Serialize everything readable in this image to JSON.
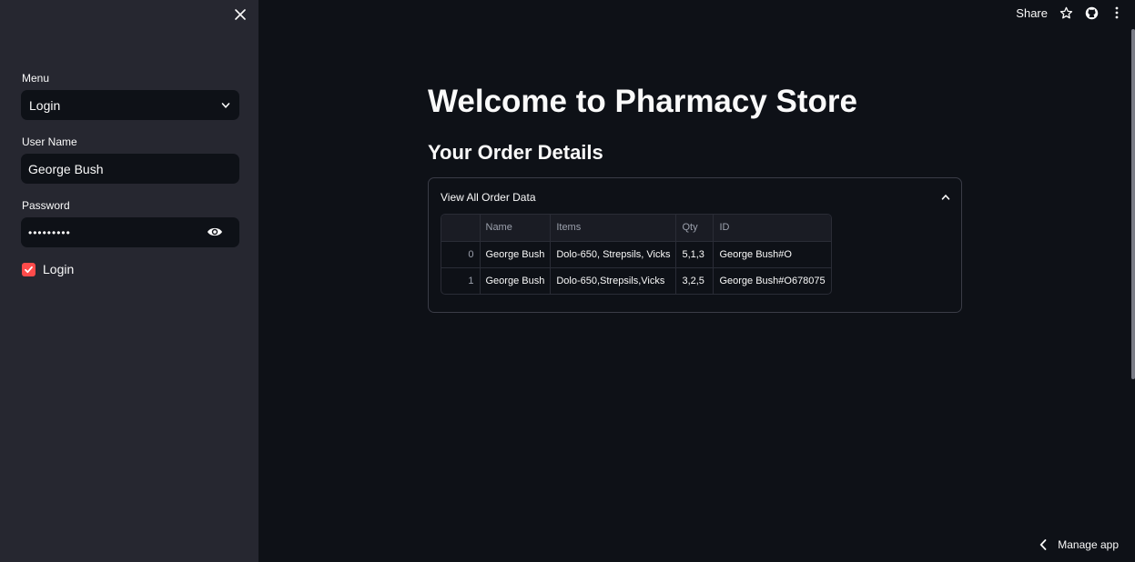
{
  "sidebar": {
    "close_icon": "close-icon",
    "menu_label": "Menu",
    "menu_value": "Login",
    "username_label": "User Name",
    "username_value": "George Bush",
    "password_label": "Password",
    "password_value": "•••••••••",
    "login_checkbox_label": "Login",
    "login_checked": true
  },
  "toolbar": {
    "share_label": "Share"
  },
  "main": {
    "title": "Welcome to Pharmacy Store",
    "subtitle": "Your Order Details",
    "expander_label": "View All Order Data",
    "table": {
      "columns": [
        "",
        "Name",
        "Items",
        "Qty",
        "ID"
      ],
      "rows": [
        [
          "0",
          "George Bush",
          "Dolo-650, Strepsils, Vicks",
          "5,1,3",
          "George Bush#O"
        ],
        [
          "1",
          "George Bush",
          "Dolo-650,Strepsils,Vicks",
          "3,2,5",
          "George Bush#O678075"
        ]
      ]
    }
  },
  "footer": {
    "manage_label": "Manage app"
  },
  "colors": {
    "background": "#0e1117",
    "sidebar": "#262730",
    "accent": "#ff4b4b"
  }
}
